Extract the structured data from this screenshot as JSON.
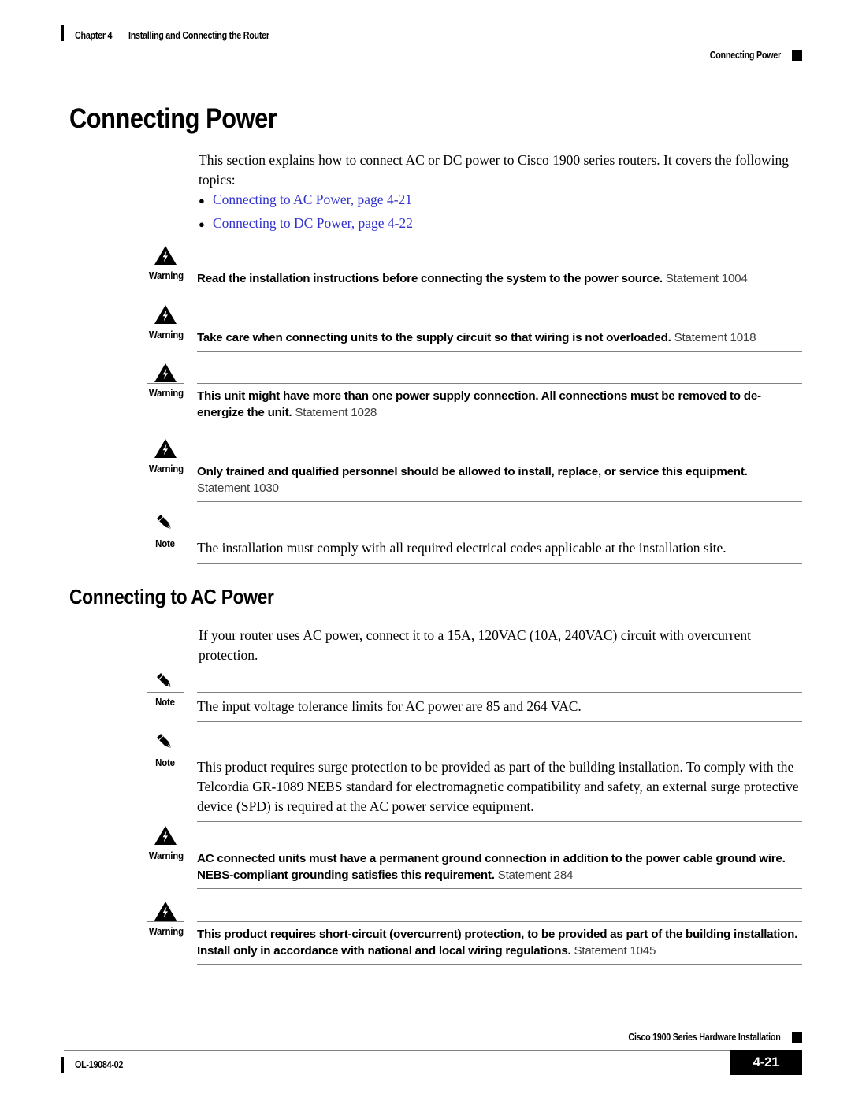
{
  "header": {
    "chapter": "Chapter 4",
    "chapter_title": "Installing and Connecting the Router",
    "section": "Connecting Power"
  },
  "main": {
    "title": "Connecting Power",
    "intro": "This section explains how to connect AC or DC power to Cisco 1900 series routers. It covers the following topics:",
    "bullets": [
      {
        "text": "Connecting to AC Power, page 4-21"
      },
      {
        "text": "Connecting to DC Power, page 4-22"
      }
    ],
    "section_heading": "Connecting to AC Power",
    "ac_intro": "If your router uses AC power, connect it to a 15A, 120VAC (10A, 240VAC) circuit with overcurrent protection."
  },
  "admonitions_top": [
    {
      "kind": "warning",
      "label": "Warning",
      "icon": "warning-triangle-icon",
      "bold": "Read the installation instructions before connecting the system to the power source.",
      "statement": " Statement 1004"
    },
    {
      "kind": "warning",
      "label": "Warning",
      "icon": "warning-triangle-icon",
      "bold": "Take care when connecting units to the supply circuit so that wiring is not overloaded.",
      "statement": " Statement 1018"
    },
    {
      "kind": "warning",
      "label": "Warning",
      "icon": "warning-triangle-icon",
      "bold": "This unit might have more than one power supply connection. All connections must be removed to de-energize the unit.",
      "statement": " Statement 1028"
    },
    {
      "kind": "warning",
      "label": "Warning",
      "icon": "warning-triangle-icon",
      "bold": "Only trained and qualified personnel should be allowed to install, replace, or service this equipment.",
      "statement": " Statement 1030"
    },
    {
      "kind": "note",
      "label": "Note",
      "icon": "note-pencil-icon",
      "bold": "The installation must comply with all required electrical codes applicable at the installation site.",
      "statement": ""
    }
  ],
  "admonitions_bottom": [
    {
      "kind": "note",
      "label": "Note",
      "icon": "note-pencil-icon",
      "bold": "The input voltage tolerance limits for AC power are 85 and 264 VAC.",
      "statement": ""
    },
    {
      "kind": "note",
      "label": "Note",
      "icon": "note-pencil-icon",
      "bold": "This product requires surge protection to be provided as part of the building installation. To comply with the Telcordia GR-1089 NEBS standard for electromagnetic compatibility and safety, an external surge protective device (SPD) is required at the AC power service equipment.",
      "statement": ""
    },
    {
      "kind": "warning",
      "label": "Warning",
      "icon": "warning-triangle-icon",
      "bold": "AC connected units must have a permanent ground connection in addition to the power cable ground wire. NEBS-compliant grounding satisfies this requirement.",
      "statement": " Statement 284"
    },
    {
      "kind": "warning",
      "label": "Warning",
      "icon": "warning-triangle-icon",
      "bold": "This product requires short-circuit (overcurrent) protection, to be provided as part of the building installation. Install only in accordance with national and local wiring regulations.",
      "statement": " Statement 1045"
    }
  ],
  "footer": {
    "doc_title": "Cisco 1900 Series Hardware Installation",
    "doc_id": "OL-19084-02",
    "page_number": "4-21"
  },
  "colors": {
    "link": "#3333cc",
    "rule": "#808080",
    "statement": "#3f3f3f"
  }
}
